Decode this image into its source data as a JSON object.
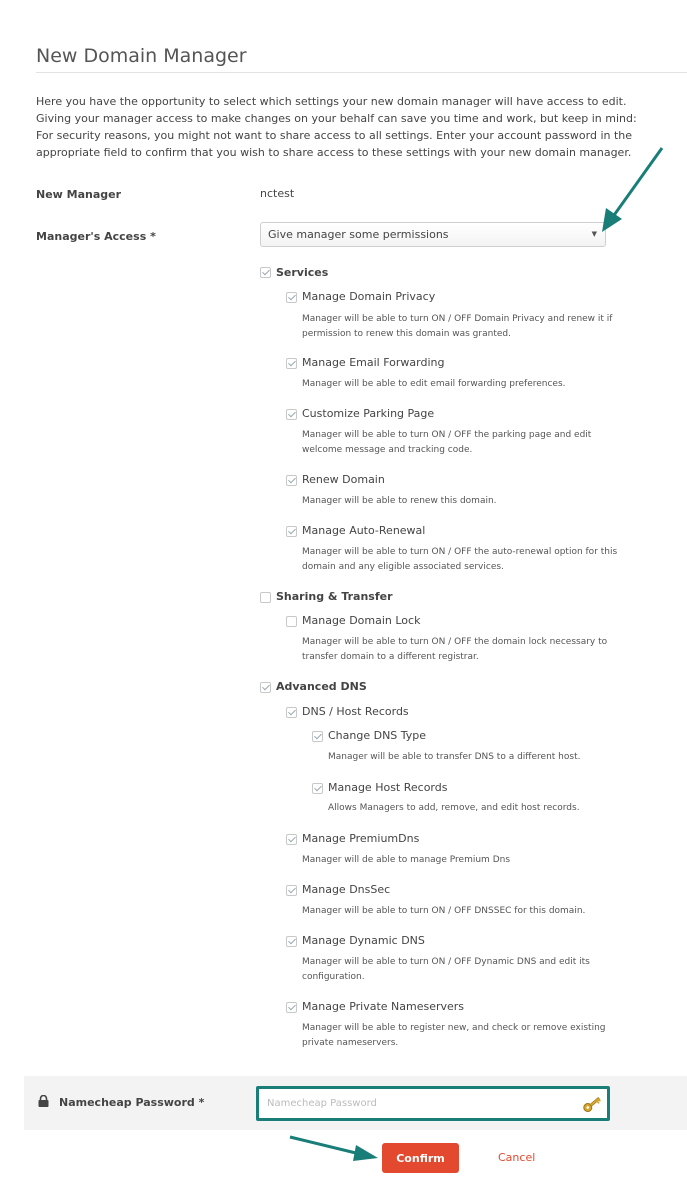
{
  "page": {
    "title": "New Domain Manager",
    "intro": "Here you have the opportunity to select which settings your new domain manager will have access to edit. Giving your manager access to make changes on your behalf can save you time and work, but keep in mind: For security reasons, you might not want to share access to all settings. Enter your account password in the appropriate field to confirm that you wish to share access to these settings with your new domain manager."
  },
  "form": {
    "manager_label": "New Manager",
    "manager_value": "nctest",
    "access_label": "Manager's Access *",
    "access_value": "Give manager some permissions",
    "password_label": "Namecheap Password *",
    "password_placeholder": "Namecheap Password",
    "confirm_label": "Confirm",
    "cancel_label": "Cancel"
  },
  "permissions": {
    "services": {
      "label": "Services",
      "checked": true
    },
    "domain_privacy": {
      "label": "Manage Domain Privacy",
      "desc": "Manager will be able to turn ON / OFF Domain Privacy and renew it if permission to renew this domain was granted."
    },
    "email_forwarding": {
      "label": "Manage Email Forwarding",
      "desc": "Manager will be able to edit email forwarding preferences."
    },
    "parking_page": {
      "label": "Customize Parking Page",
      "desc": "Manager will be able to turn ON / OFF the parking page and edit welcome message and tracking code."
    },
    "renew_domain": {
      "label": "Renew Domain",
      "desc": "Manager will be able to renew this domain."
    },
    "auto_renewal": {
      "label": "Manage Auto-Renewal",
      "desc": "Manager will be able to turn ON / OFF the auto-renewal option for this domain and any eligible associated services."
    },
    "sharing_transfer": {
      "label": "Sharing & Transfer",
      "checked": false
    },
    "domain_lock": {
      "label": "Manage Domain Lock",
      "desc": "Manager will be able to turn ON / OFF the domain lock necessary to transfer domain to a different registrar."
    },
    "advanced_dns": {
      "label": "Advanced DNS",
      "checked": true
    },
    "dns_host_records": {
      "label": "DNS / Host Records"
    },
    "change_dns_type": {
      "label": "Change DNS Type",
      "desc": "Manager will be able to transfer DNS to a different host."
    },
    "manage_host_records": {
      "label": "Manage Host Records",
      "desc": "Allows Managers to add, remove, and edit host records."
    },
    "premium_dns": {
      "label": "Manage PremiumDns",
      "desc": "Manager will de able to manage Premium Dns"
    },
    "dnssec": {
      "label": "Manage DnsSec",
      "desc": "Manager will be able to turn ON / OFF DNSSEC for this domain."
    },
    "dynamic_dns": {
      "label": "Manage Dynamic DNS",
      "desc": "Manager will be able to turn ON / OFF Dynamic DNS and edit its configuration."
    },
    "private_ns": {
      "label": "Manage Private Nameservers",
      "desc": "Manager will be able to register new, and check or remove existing private nameservers."
    }
  },
  "colors": {
    "accent": "#1a7e78",
    "confirm": "#e2492f"
  },
  "icons": [
    "lock-icon",
    "key-icon",
    "chevron-down-icon",
    "arrow-icon"
  ]
}
